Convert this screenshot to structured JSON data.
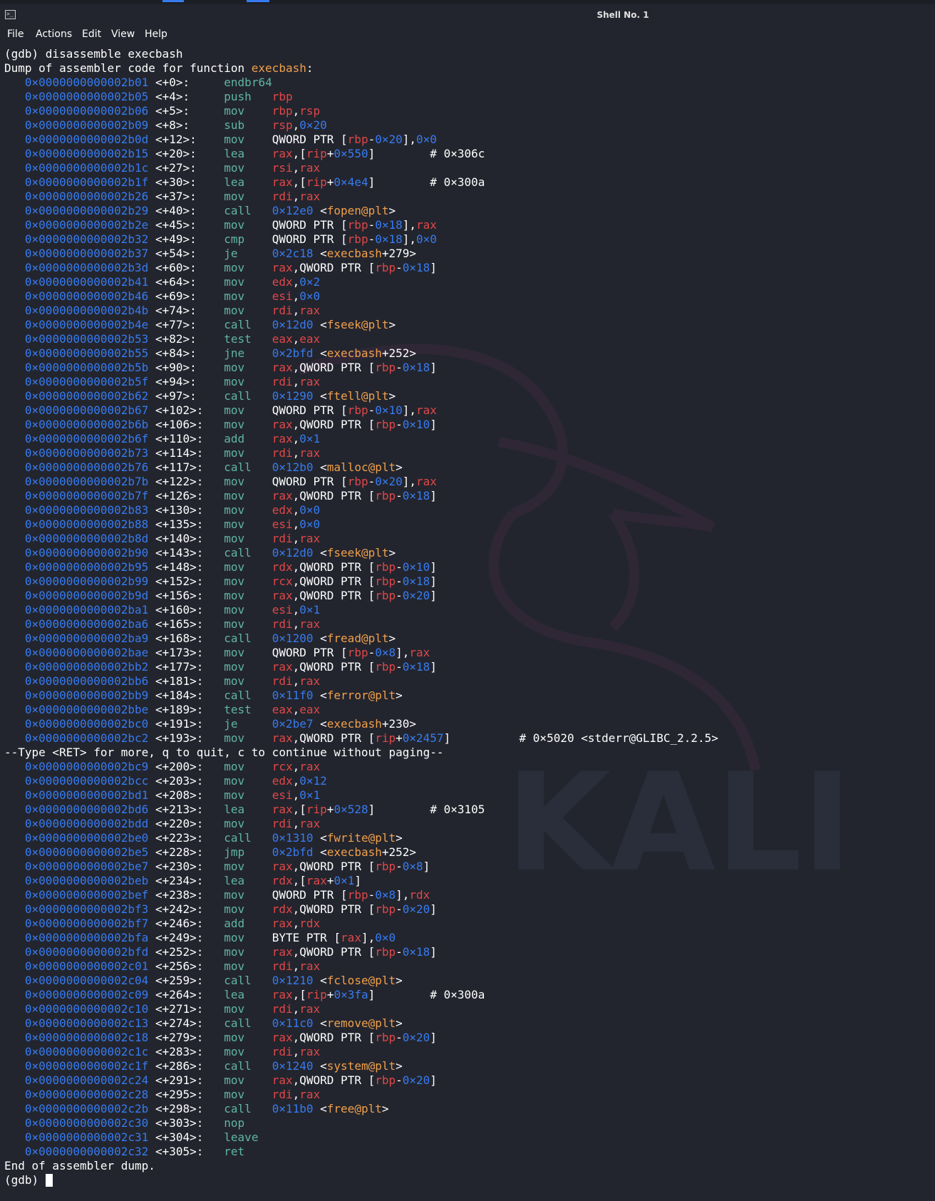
{
  "window": {
    "title": "Shell No. 1",
    "icon": "terminal-icon"
  },
  "menu": [
    "File",
    "Actions",
    "Edit",
    "View",
    "Help"
  ],
  "watermark_text": "KALI",
  "colors": {
    "background": "#23252e",
    "address": "#367bf0",
    "opcode": "#5fb5a5",
    "register": "#e04848",
    "function": "#f0a04b",
    "text": "#ffffff"
  },
  "terminal": {
    "lines": [
      {
        "type": "text",
        "text": "(gdb) disassemble execbash"
      },
      {
        "type": "header",
        "prefix": "Dump of assembler code for function ",
        "fn": "execbash",
        "suffix": ":"
      },
      {
        "type": "asm",
        "addr": "0×0000000000002b01",
        "off": "<+0>:",
        "op": "endbr64",
        "args": "",
        "comment": ""
      },
      {
        "type": "asm",
        "addr": "0×0000000000002b05",
        "off": "<+4>:",
        "op": "push",
        "args": "%rbp",
        "comment": ""
      },
      {
        "type": "asm",
        "addr": "0×0000000000002b06",
        "off": "<+5>:",
        "op": "mov",
        "args": "%rbp,%rsp",
        "comment": ""
      },
      {
        "type": "asm",
        "addr": "0×0000000000002b09",
        "off": "<+8>:",
        "op": "sub",
        "args": "%rsp,#0×20",
        "comment": ""
      },
      {
        "type": "asm",
        "addr": "0×0000000000002b0d",
        "off": "<+12>:",
        "op": "mov",
        "args": "QWORD PTR [%rbp-#0×20],#0×0",
        "comment": ""
      },
      {
        "type": "asm",
        "addr": "0×0000000000002b15",
        "off": "<+20>:",
        "op": "lea",
        "args": "%rax,[%rip+#0×550]",
        "comment": "# 0×306c"
      },
      {
        "type": "asm",
        "addr": "0×0000000000002b1c",
        "off": "<+27>:",
        "op": "mov",
        "args": "%rsi,%rax",
        "comment": ""
      },
      {
        "type": "asm",
        "addr": "0×0000000000002b1f",
        "off": "<+30>:",
        "op": "lea",
        "args": "%rax,[%rip+#0×4e4]",
        "comment": "# 0×300a"
      },
      {
        "type": "asm",
        "addr": "0×0000000000002b26",
        "off": "<+37>:",
        "op": "mov",
        "args": "%rdi,%rax",
        "comment": ""
      },
      {
        "type": "asm",
        "addr": "0×0000000000002b29",
        "off": "<+40>:",
        "op": "call",
        "args": "#0×12e0 <@fopen@plt>",
        "comment": ""
      },
      {
        "type": "asm",
        "addr": "0×0000000000002b2e",
        "off": "<+45>:",
        "op": "mov",
        "args": "QWORD PTR [%rbp-#0×18],%rax",
        "comment": ""
      },
      {
        "type": "asm",
        "addr": "0×0000000000002b32",
        "off": "<+49>:",
        "op": "cmp",
        "args": "QWORD PTR [%rbp-#0×18],#0×0",
        "comment": ""
      },
      {
        "type": "asm",
        "addr": "0×0000000000002b37",
        "off": "<+54>:",
        "op": "je",
        "args": "#0×2c18 <@execbash+279>",
        "comment": ""
      },
      {
        "type": "asm",
        "addr": "0×0000000000002b3d",
        "off": "<+60>:",
        "op": "mov",
        "args": "%rax,QWORD PTR [%rbp-#0×18]",
        "comment": ""
      },
      {
        "type": "asm",
        "addr": "0×0000000000002b41",
        "off": "<+64>:",
        "op": "mov",
        "args": "%edx,#0×2",
        "comment": ""
      },
      {
        "type": "asm",
        "addr": "0×0000000000002b46",
        "off": "<+69>:",
        "op": "mov",
        "args": "%esi,#0×0",
        "comment": ""
      },
      {
        "type": "asm",
        "addr": "0×0000000000002b4b",
        "off": "<+74>:",
        "op": "mov",
        "args": "%rdi,%rax",
        "comment": ""
      },
      {
        "type": "asm",
        "addr": "0×0000000000002b4e",
        "off": "<+77>:",
        "op": "call",
        "args": "#0×12d0 <@fseek@plt>",
        "comment": ""
      },
      {
        "type": "asm",
        "addr": "0×0000000000002b53",
        "off": "<+82>:",
        "op": "test",
        "args": "%eax,%eax",
        "comment": ""
      },
      {
        "type": "asm",
        "addr": "0×0000000000002b55",
        "off": "<+84>:",
        "op": "jne",
        "args": "#0×2bfd <@execbash+252>",
        "comment": ""
      },
      {
        "type": "asm",
        "addr": "0×0000000000002b5b",
        "off": "<+90>:",
        "op": "mov",
        "args": "%rax,QWORD PTR [%rbp-#0×18]",
        "comment": ""
      },
      {
        "type": "asm",
        "addr": "0×0000000000002b5f",
        "off": "<+94>:",
        "op": "mov",
        "args": "%rdi,%rax",
        "comment": ""
      },
      {
        "type": "asm",
        "addr": "0×0000000000002b62",
        "off": "<+97>:",
        "op": "call",
        "args": "#0×1290 <@ftell@plt>",
        "comment": ""
      },
      {
        "type": "asm",
        "addr": "0×0000000000002b67",
        "off": "<+102>:",
        "op": "mov",
        "args": "QWORD PTR [%rbp-#0×10],%rax",
        "comment": ""
      },
      {
        "type": "asm",
        "addr": "0×0000000000002b6b",
        "off": "<+106>:",
        "op": "mov",
        "args": "%rax,QWORD PTR [%rbp-#0×10]",
        "comment": ""
      },
      {
        "type": "asm",
        "addr": "0×0000000000002b6f",
        "off": "<+110>:",
        "op": "add",
        "args": "%rax,#0×1",
        "comment": ""
      },
      {
        "type": "asm",
        "addr": "0×0000000000002b73",
        "off": "<+114>:",
        "op": "mov",
        "args": "%rdi,%rax",
        "comment": ""
      },
      {
        "type": "asm",
        "addr": "0×0000000000002b76",
        "off": "<+117>:",
        "op": "call",
        "args": "#0×12b0 <@malloc@plt>",
        "comment": ""
      },
      {
        "type": "asm",
        "addr": "0×0000000000002b7b",
        "off": "<+122>:",
        "op": "mov",
        "args": "QWORD PTR [%rbp-#0×20],%rax",
        "comment": ""
      },
      {
        "type": "asm",
        "addr": "0×0000000000002b7f",
        "off": "<+126>:",
        "op": "mov",
        "args": "%rax,QWORD PTR [%rbp-#0×18]",
        "comment": ""
      },
      {
        "type": "asm",
        "addr": "0×0000000000002b83",
        "off": "<+130>:",
        "op": "mov",
        "args": "%edx,#0×0",
        "comment": ""
      },
      {
        "type": "asm",
        "addr": "0×0000000000002b88",
        "off": "<+135>:",
        "op": "mov",
        "args": "%esi,#0×0",
        "comment": ""
      },
      {
        "type": "asm",
        "addr": "0×0000000000002b8d",
        "off": "<+140>:",
        "op": "mov",
        "args": "%rdi,%rax",
        "comment": ""
      },
      {
        "type": "asm",
        "addr": "0×0000000000002b90",
        "off": "<+143>:",
        "op": "call",
        "args": "#0×12d0 <@fseek@plt>",
        "comment": ""
      },
      {
        "type": "asm",
        "addr": "0×0000000000002b95",
        "off": "<+148>:",
        "op": "mov",
        "args": "%rdx,QWORD PTR [%rbp-#0×10]",
        "comment": ""
      },
      {
        "type": "asm",
        "addr": "0×0000000000002b99",
        "off": "<+152>:",
        "op": "mov",
        "args": "%rcx,QWORD PTR [%rbp-#0×18]",
        "comment": ""
      },
      {
        "type": "asm",
        "addr": "0×0000000000002b9d",
        "off": "<+156>:",
        "op": "mov",
        "args": "%rax,QWORD PTR [%rbp-#0×20]",
        "comment": ""
      },
      {
        "type": "asm",
        "addr": "0×0000000000002ba1",
        "off": "<+160>:",
        "op": "mov",
        "args": "%esi,#0×1",
        "comment": ""
      },
      {
        "type": "asm",
        "addr": "0×0000000000002ba6",
        "off": "<+165>:",
        "op": "mov",
        "args": "%rdi,%rax",
        "comment": ""
      },
      {
        "type": "asm",
        "addr": "0×0000000000002ba9",
        "off": "<+168>:",
        "op": "call",
        "args": "#0×1200 <@fread@plt>",
        "comment": ""
      },
      {
        "type": "asm",
        "addr": "0×0000000000002bae",
        "off": "<+173>:",
        "op": "mov",
        "args": "QWORD PTR [%rbp-#0×8],%rax",
        "comment": ""
      },
      {
        "type": "asm",
        "addr": "0×0000000000002bb2",
        "off": "<+177>:",
        "op": "mov",
        "args": "%rax,QWORD PTR [%rbp-#0×18]",
        "comment": ""
      },
      {
        "type": "asm",
        "addr": "0×0000000000002bb6",
        "off": "<+181>:",
        "op": "mov",
        "args": "%rdi,%rax",
        "comment": ""
      },
      {
        "type": "asm",
        "addr": "0×0000000000002bb9",
        "off": "<+184>:",
        "op": "call",
        "args": "#0×11f0 <@ferror@plt>",
        "comment": ""
      },
      {
        "type": "asm",
        "addr": "0×0000000000002bbe",
        "off": "<+189>:",
        "op": "test",
        "args": "%eax,%eax",
        "comment": ""
      },
      {
        "type": "asm",
        "addr": "0×0000000000002bc0",
        "off": "<+191>:",
        "op": "je",
        "args": "#0×2be7 <@execbash+230>",
        "comment": ""
      },
      {
        "type": "asm",
        "addr": "0×0000000000002bc2",
        "off": "<+193>:",
        "op": "mov",
        "args": "%rax,QWORD PTR [%rip+#0×2457]",
        "comment": "# 0×5020 <stderr@GLIBC_2.2.5>",
        "wide": true
      },
      {
        "type": "text",
        "text": "--Type <RET> for more, q to quit, c to continue without paging--"
      },
      {
        "type": "asm",
        "addr": "0×0000000000002bc9",
        "off": "<+200>:",
        "op": "mov",
        "args": "%rcx,%rax",
        "comment": ""
      },
      {
        "type": "asm",
        "addr": "0×0000000000002bcc",
        "off": "<+203>:",
        "op": "mov",
        "args": "%edx,#0×12",
        "comment": ""
      },
      {
        "type": "asm",
        "addr": "0×0000000000002bd1",
        "off": "<+208>:",
        "op": "mov",
        "args": "%esi,#0×1",
        "comment": ""
      },
      {
        "type": "asm",
        "addr": "0×0000000000002bd6",
        "off": "<+213>:",
        "op": "lea",
        "args": "%rax,[%rip+#0×528]",
        "comment": "# 0×3105"
      },
      {
        "type": "asm",
        "addr": "0×0000000000002bdd",
        "off": "<+220>:",
        "op": "mov",
        "args": "%rdi,%rax",
        "comment": ""
      },
      {
        "type": "asm",
        "addr": "0×0000000000002be0",
        "off": "<+223>:",
        "op": "call",
        "args": "#0×1310 <@fwrite@plt>",
        "comment": ""
      },
      {
        "type": "asm",
        "addr": "0×0000000000002be5",
        "off": "<+228>:",
        "op": "jmp",
        "args": "#0×2bfd <@execbash+252>",
        "comment": ""
      },
      {
        "type": "asm",
        "addr": "0×0000000000002be7",
        "off": "<+230>:",
        "op": "mov",
        "args": "%rax,QWORD PTR [%rbp-#0×8]",
        "comment": ""
      },
      {
        "type": "asm",
        "addr": "0×0000000000002beb",
        "off": "<+234>:",
        "op": "lea",
        "args": "%rdx,[%rax+#0×1]",
        "comment": ""
      },
      {
        "type": "asm",
        "addr": "0×0000000000002bef",
        "off": "<+238>:",
        "op": "mov",
        "args": "QWORD PTR [%rbp-#0×8],%rdx",
        "comment": ""
      },
      {
        "type": "asm",
        "addr": "0×0000000000002bf3",
        "off": "<+242>:",
        "op": "mov",
        "args": "%rdx,QWORD PTR [%rbp-#0×20]",
        "comment": ""
      },
      {
        "type": "asm",
        "addr": "0×0000000000002bf7",
        "off": "<+246>:",
        "op": "add",
        "args": "%rax,%rdx",
        "comment": ""
      },
      {
        "type": "asm",
        "addr": "0×0000000000002bfa",
        "off": "<+249>:",
        "op": "mov",
        "args": "BYTE PTR [%rax],#0×0",
        "comment": ""
      },
      {
        "type": "asm",
        "addr": "0×0000000000002bfd",
        "off": "<+252>:",
        "op": "mov",
        "args": "%rax,QWORD PTR [%rbp-#0×18]",
        "comment": ""
      },
      {
        "type": "asm",
        "addr": "0×0000000000002c01",
        "off": "<+256>:",
        "op": "mov",
        "args": "%rdi,%rax",
        "comment": ""
      },
      {
        "type": "asm",
        "addr": "0×0000000000002c04",
        "off": "<+259>:",
        "op": "call",
        "args": "#0×1210 <@fclose@plt>",
        "comment": ""
      },
      {
        "type": "asm",
        "addr": "0×0000000000002c09",
        "off": "<+264>:",
        "op": "lea",
        "args": "%rax,[%rip+#0×3fa]",
        "comment": "# 0×300a"
      },
      {
        "type": "asm",
        "addr": "0×0000000000002c10",
        "off": "<+271>:",
        "op": "mov",
        "args": "%rdi,%rax",
        "comment": ""
      },
      {
        "type": "asm",
        "addr": "0×0000000000002c13",
        "off": "<+274>:",
        "op": "call",
        "args": "#0×11c0 <@remove@plt>",
        "comment": ""
      },
      {
        "type": "asm",
        "addr": "0×0000000000002c18",
        "off": "<+279>:",
        "op": "mov",
        "args": "%rax,QWORD PTR [%rbp-#0×20]",
        "comment": ""
      },
      {
        "type": "asm",
        "addr": "0×0000000000002c1c",
        "off": "<+283>:",
        "op": "mov",
        "args": "%rdi,%rax",
        "comment": ""
      },
      {
        "type": "asm",
        "addr": "0×0000000000002c1f",
        "off": "<+286>:",
        "op": "call",
        "args": "#0×1240 <@system@plt>",
        "comment": ""
      },
      {
        "type": "asm",
        "addr": "0×0000000000002c24",
        "off": "<+291>:",
        "op": "mov",
        "args": "%rax,QWORD PTR [%rbp-#0×20]",
        "comment": ""
      },
      {
        "type": "asm",
        "addr": "0×0000000000002c28",
        "off": "<+295>:",
        "op": "mov",
        "args": "%rdi,%rax",
        "comment": ""
      },
      {
        "type": "asm",
        "addr": "0×0000000000002c2b",
        "off": "<+298>:",
        "op": "call",
        "args": "#0×11b0 <@free@plt>",
        "comment": ""
      },
      {
        "type": "asm",
        "addr": "0×0000000000002c30",
        "off": "<+303>:",
        "op": "nop",
        "args": "",
        "comment": ""
      },
      {
        "type": "asm",
        "addr": "0×0000000000002c31",
        "off": "<+304>:",
        "op": "leave",
        "args": "",
        "comment": ""
      },
      {
        "type": "asm",
        "addr": "0×0000000000002c32",
        "off": "<+305>:",
        "op": "ret",
        "args": "",
        "comment": ""
      },
      {
        "type": "text",
        "text": "End of assembler dump."
      },
      {
        "type": "prompt",
        "text": "(gdb) "
      }
    ]
  }
}
